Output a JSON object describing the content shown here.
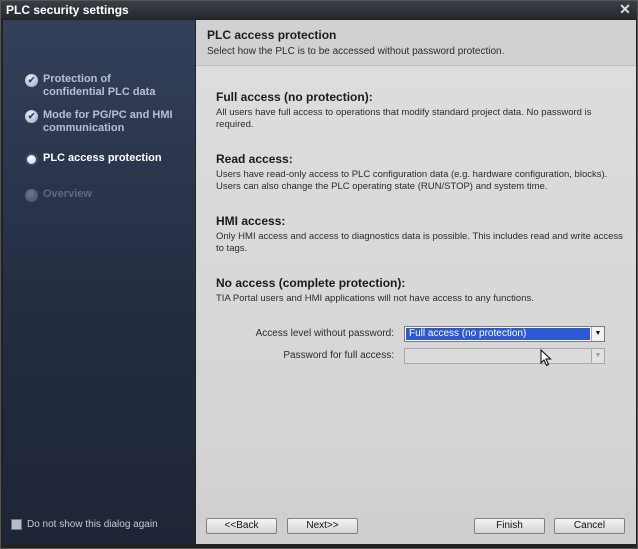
{
  "window": {
    "title": "PLC security settings"
  },
  "sidebar": {
    "items": [
      {
        "label_line1": "Protection of",
        "label_line2": "confidential PLC data",
        "state": "done"
      },
      {
        "label_line1": "Mode for PG/PC and HMI",
        "label_line2": "communication",
        "state": "done"
      },
      {
        "label_line1": "PLC access protection",
        "label_line2": "",
        "state": "active"
      },
      {
        "label_line1": "Overview",
        "label_line2": "",
        "state": "off"
      }
    ],
    "dont_show_label": "Do not show this dialog again"
  },
  "header": {
    "title": "PLC access protection",
    "subtitle": "Select how the PLC is to be accessed without password protection."
  },
  "sections": [
    {
      "title": "Full access (no protection):",
      "desc": "All users have full access to operations that modify standard project data. No password is required."
    },
    {
      "title": "Read access:",
      "desc": "Users have read-only access to PLC configuration data (e.g. hardware configuration, blocks). Users can also change the PLC operating state (RUN/STOP) and system time."
    },
    {
      "title": "HMI access:",
      "desc": "Only HMI access and access to diagnostics data is possible. This includes read and write access to tags."
    },
    {
      "title": "No access (complete protection):",
      "desc": "TIA Portal users and HMI applications will not have access to any functions."
    }
  ],
  "form": {
    "access_level_label": "Access level without password:",
    "access_level_value": "Full access (no protection)",
    "password_label": "Password for full access:",
    "password_value": ""
  },
  "buttons": {
    "back": "<<Back",
    "next": "Next>>",
    "finish": "Finish",
    "cancel": "Cancel"
  },
  "colors": {
    "selection": "#2a58d6",
    "sidebar_top": "#34405a",
    "sidebar_bottom": "#1e2537"
  }
}
